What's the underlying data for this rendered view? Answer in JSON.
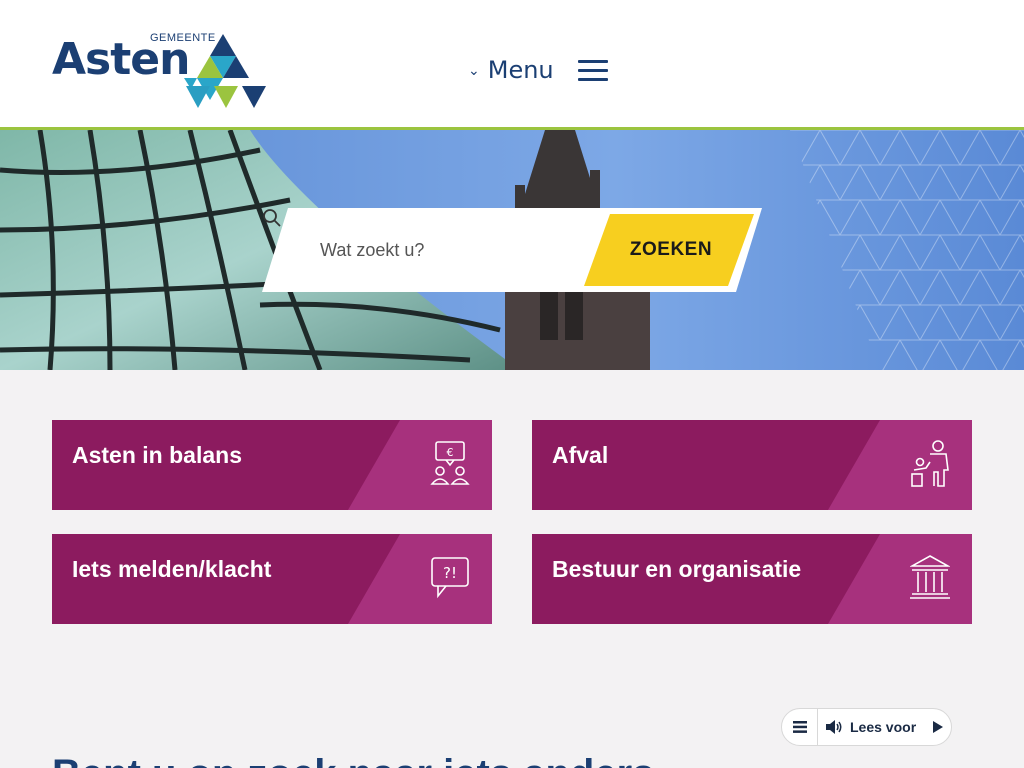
{
  "header": {
    "logo_word": "Asten",
    "logo_sub": "GEMEENTE",
    "menu_chevron": "⌄",
    "menu_label": "Menu"
  },
  "search": {
    "placeholder": "Wat zoekt u?",
    "button_label": "ZOEKEN"
  },
  "tiles": [
    {
      "label": "Asten in balans",
      "icon": "people-euro-icon"
    },
    {
      "label": "Afval",
      "icon": "person-trash-icon"
    },
    {
      "label": "Iets melden/klacht",
      "icon": "question-exclamation-icon"
    },
    {
      "label": "Bestuur en organisatie",
      "icon": "government-building-icon"
    }
  ],
  "bottom": {
    "heading": "Bent u op zoek naar iets anders?"
  },
  "readspeaker": {
    "label": "Lees voor"
  },
  "colors": {
    "brand_blue": "#1b3f73",
    "accent_green": "#9bc43f",
    "tile_purple": "#8c1b5f",
    "tile_slant": "#a7317d",
    "search_yellow": "#f7cf1f"
  }
}
